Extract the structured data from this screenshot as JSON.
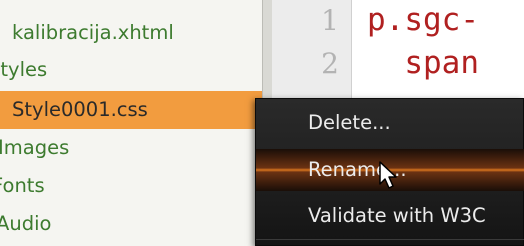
{
  "tree": {
    "items": [
      {
        "label": "kalibracija.xhtml",
        "selected": false
      },
      {
        "label": "Styles",
        "selected": false
      },
      {
        "label": "Style0001.css",
        "selected": true
      },
      {
        "label": "Images",
        "selected": false
      },
      {
        "label": "Fonts",
        "selected": false
      },
      {
        "label": "Audio",
        "selected": false
      }
    ]
  },
  "editor": {
    "line_numbers": [
      "1",
      "2"
    ],
    "lines": [
      "p.sgc-",
      "  span"
    ]
  },
  "context_menu": {
    "items": [
      {
        "label": "Delete...",
        "hovered": false
      },
      {
        "label": "Rename...",
        "hovered": true
      },
      {
        "label": "Validate with W3C",
        "hovered": false
      }
    ]
  },
  "colors": {
    "tree_text": "#3d7b2f",
    "selection": "#f29c3f",
    "code_text": "#b02020",
    "menu_bg": "#1e1e1e",
    "menu_hover": "#d8751e"
  },
  "icons": {
    "cursor": "mouse-pointer-icon"
  }
}
